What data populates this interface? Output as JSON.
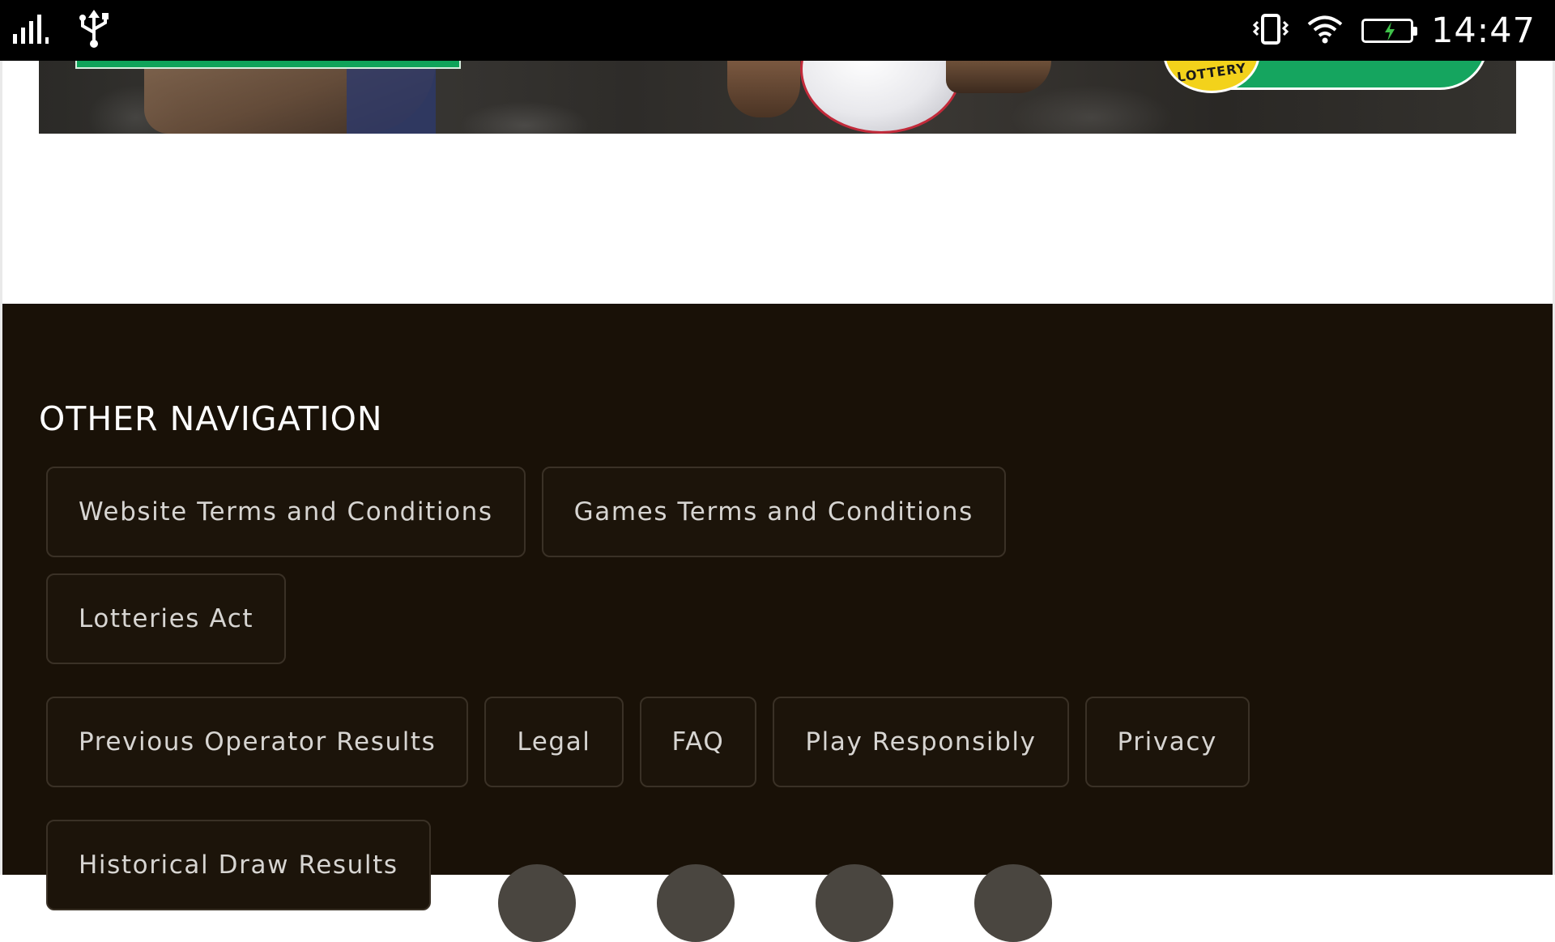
{
  "status_bar": {
    "time": "14:47",
    "icons": [
      "signal-icon",
      "usb-icon",
      "vibrate-icon",
      "wifi-icon",
      "battery-charging-icon"
    ]
  },
  "banner": {
    "logo_text": "LOTTERY"
  },
  "footer": {
    "heading": "OTHER NAVIGATION",
    "links": [
      "Website Terms and Conditions",
      "Games Terms and Conditions",
      "Lotteries Act",
      "Previous Operator Results",
      "Legal",
      "FAQ",
      "Play Responsibly",
      "Privacy",
      "Historical Draw Results"
    ],
    "social_icons": [
      "social-icon-1",
      "social-icon-2",
      "social-icon-3",
      "social-icon-4"
    ]
  },
  "colors": {
    "footer_bg": "#191107",
    "pill_border": "#3a3126",
    "pill_text": "#d7d5d2",
    "brand_green": "#15a55f",
    "brand_yellow": "#f3d21b"
  }
}
